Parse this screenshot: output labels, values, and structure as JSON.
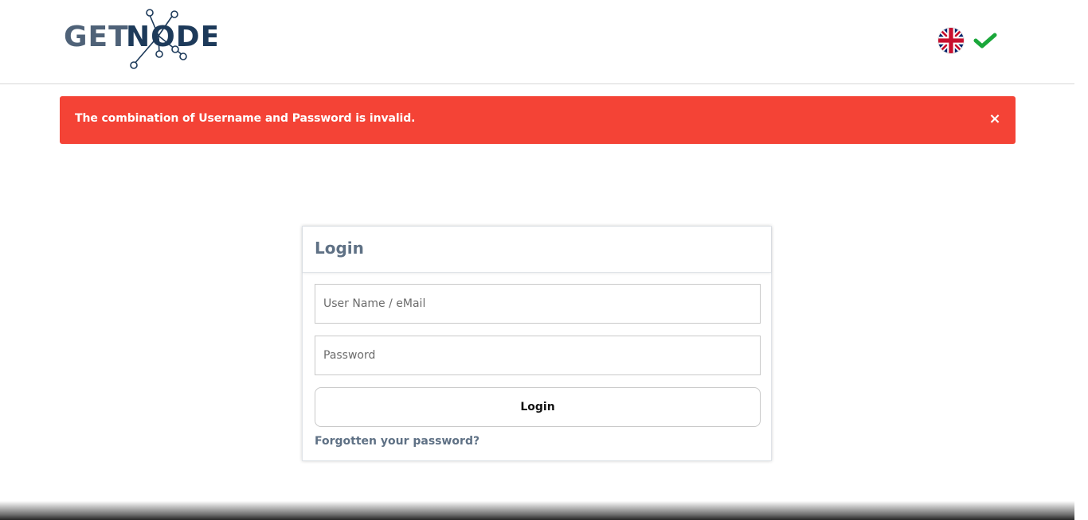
{
  "header": {
    "logo_text_left": "GET",
    "logo_text_right": "NODE",
    "language": "English",
    "language_icon": "uk-flag-icon",
    "dropdown_icon": "check-icon"
  },
  "alert": {
    "message": "The combination of Username and Password is invalid.",
    "close_glyph": "×",
    "color": "#f44336"
  },
  "login": {
    "title": "Login",
    "username_placeholder": "User Name / eMail",
    "username_value": "",
    "password_placeholder": "Password",
    "password_value": "",
    "button_label": "Login",
    "forgot_link": "Forgotten your password?"
  },
  "colors": {
    "accent": "#5f7185",
    "logo": "#1d3a5a",
    "check": "#1aa73a"
  }
}
